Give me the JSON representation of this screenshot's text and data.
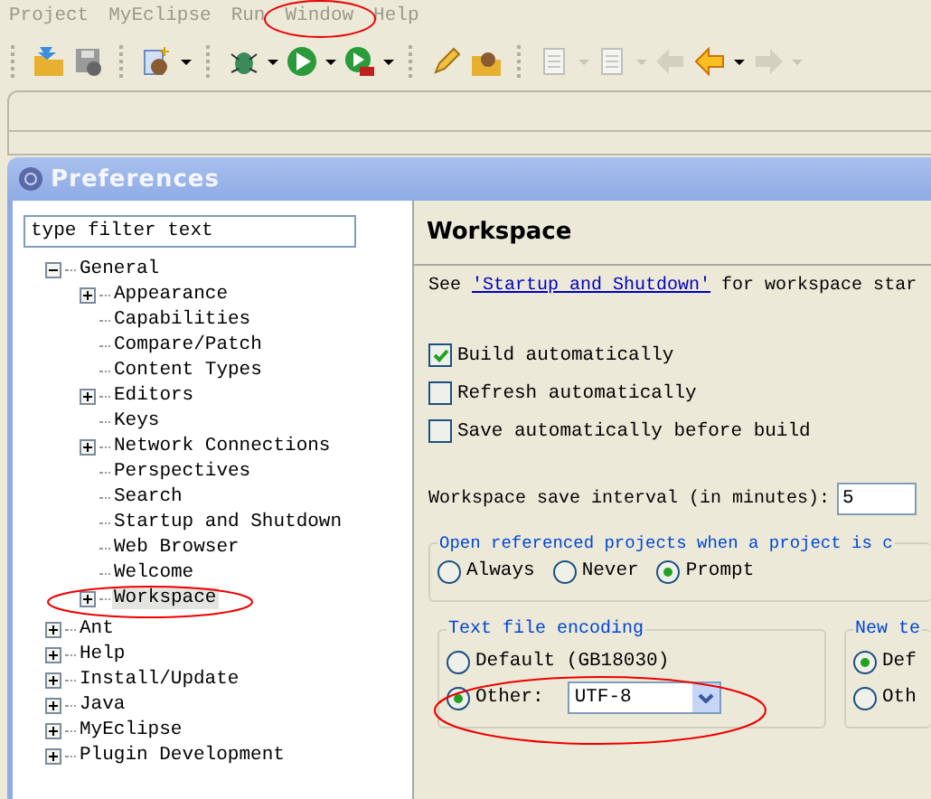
{
  "menu": [
    {
      "label": "Project"
    },
    {
      "label": "MyEclipse"
    },
    {
      "label": "Run"
    },
    {
      "label": "Window"
    },
    {
      "label": "Help"
    }
  ],
  "dialog": {
    "title": "Preferences",
    "filter": {
      "placeholder": "type filter text"
    },
    "tree": [
      {
        "label": "General",
        "expanded": true,
        "selected": false,
        "children": [
          {
            "label": "Appearance",
            "expanded": false,
            "selected": false
          },
          {
            "label": "Capabilities",
            "selected": false
          },
          {
            "label": "Compare/Patch",
            "selected": false
          },
          {
            "label": "Content Types",
            "selected": false
          },
          {
            "label": "Editors",
            "expanded": false,
            "selected": false
          },
          {
            "label": "Keys",
            "selected": false
          },
          {
            "label": "Network Connections",
            "expanded": false,
            "selected": false
          },
          {
            "label": "Perspectives",
            "selected": false
          },
          {
            "label": "Search",
            "selected": false
          },
          {
            "label": "Startup and Shutdown",
            "selected": false
          },
          {
            "label": "Web Browser",
            "selected": false
          },
          {
            "label": "Welcome",
            "selected": false
          },
          {
            "label": "Workspace",
            "expanded": false,
            "selected": true
          }
        ]
      },
      {
        "label": "Ant",
        "expanded": false,
        "selected": false
      },
      {
        "label": "Help",
        "expanded": false,
        "selected": false
      },
      {
        "label": "Install/Update",
        "expanded": false,
        "selected": false
      },
      {
        "label": "Java",
        "expanded": false,
        "selected": false
      },
      {
        "label": "MyEclipse",
        "expanded": false,
        "selected": false
      },
      {
        "label": "Plugin Development",
        "expanded": false,
        "selected": false
      }
    ],
    "page": {
      "title": "Workspace",
      "note": {
        "before": "See",
        "link": "'Startup and Shutdown'",
        "after": "for workspace star"
      },
      "checkboxes": [
        {
          "label": "Build automatically",
          "checked": true
        },
        {
          "label": "Refresh automatically",
          "checked": false
        },
        {
          "label": "Save automatically before build",
          "checked": false
        }
      ],
      "interval": {
        "label": "Workspace save interval (in minutes):",
        "value": "5"
      },
      "open_projects": {
        "title": "Open referenced projects when a project is c",
        "options": [
          {
            "label": "Always",
            "selected": false
          },
          {
            "label": "Never",
            "selected": false
          },
          {
            "label": "Prompt",
            "selected": true
          }
        ]
      },
      "encoding": {
        "title": "Text file encoding",
        "options": [
          {
            "label": "Default (GB18030)",
            "selected": false
          },
          {
            "label": "Other:",
            "selected": true,
            "value": "UTF-8"
          }
        ]
      },
      "new_text": {
        "title": "New te",
        "options": [
          {
            "label": "Def",
            "selected": true
          },
          {
            "label": "Oth",
            "selected": false
          }
        ]
      }
    }
  }
}
